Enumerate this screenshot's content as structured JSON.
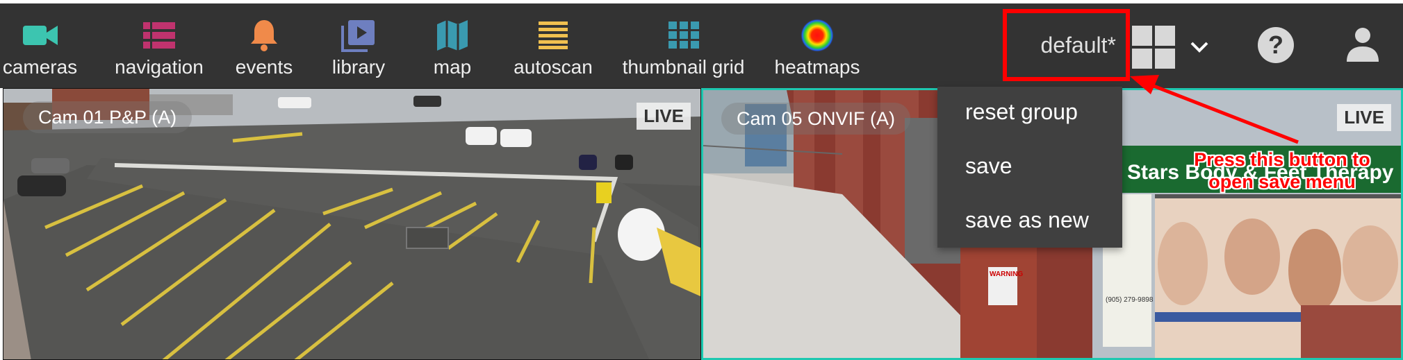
{
  "nav": {
    "items": [
      {
        "label": "cameras",
        "icon": "video-camera-icon",
        "color": "#3cc5b0"
      },
      {
        "label": "navigation",
        "icon": "list-icon",
        "color": "#c0336e"
      },
      {
        "label": "events",
        "icon": "bell-icon",
        "color": "#f08a4a"
      },
      {
        "label": "library",
        "icon": "video-library-icon",
        "color": "#6e7fc0"
      },
      {
        "label": "map",
        "icon": "map-icon",
        "color": "#3a9ab0"
      },
      {
        "label": "autoscan",
        "icon": "lines-icon",
        "color": "#f0c050"
      },
      {
        "label": "thumbnail grid",
        "icon": "grid-icon",
        "color": "#3a9ab0"
      },
      {
        "label": "heatmaps",
        "icon": "heatmap-icon",
        "color": "#ff2020"
      }
    ]
  },
  "group": {
    "name": "default*"
  },
  "group_menu": {
    "items": [
      "reset group",
      "save",
      "save as new"
    ]
  },
  "cameras": [
    {
      "title": "Cam 01 P&P (A)",
      "status": "LIVE"
    },
    {
      "title": "Cam 05 ONVIF (A)",
      "status": "LIVE"
    }
  ],
  "storefront": {
    "sign": "7 Stars Body & Feet Therapy",
    "warning": "WARNING",
    "phone": "(905) 279-9898"
  },
  "annotation": {
    "text_line1": "Press this button to",
    "text_line2": "open save menu",
    "color": "#ff0000"
  },
  "colors": {
    "topbar": "#333333",
    "accent": "#1ec8b0",
    "highlight": "#ff0000"
  }
}
